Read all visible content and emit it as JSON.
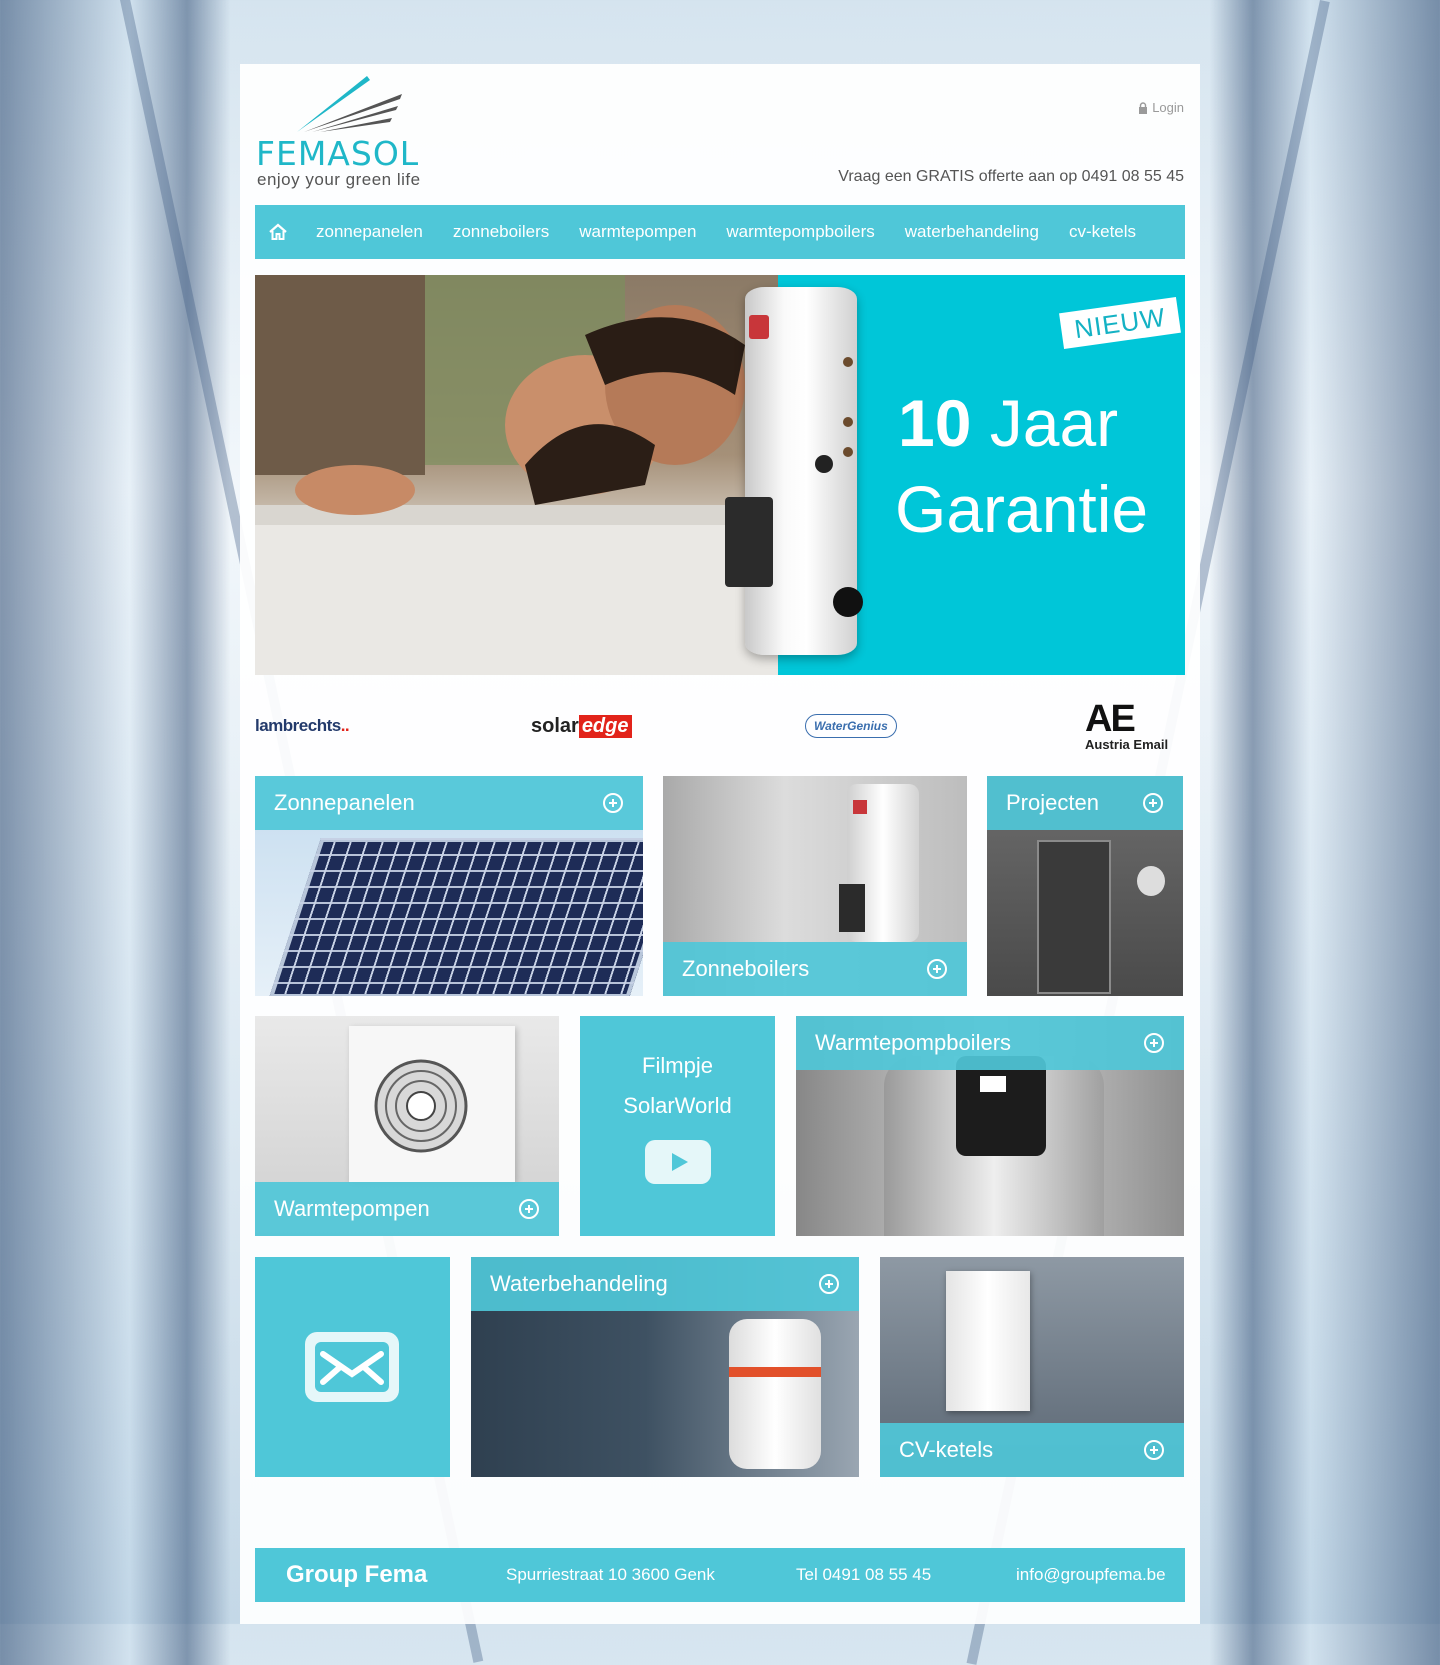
{
  "header": {
    "logo_name": "FEMASOL",
    "logo_tagline": "enjoy your green life",
    "login_label": "Login",
    "offer_text": "Vraag een GRATIS offerte aan op 0491 08 55 45"
  },
  "nav": {
    "home_icon": "home-icon",
    "items": [
      {
        "label": "zonnepanelen"
      },
      {
        "label": "zonneboilers"
      },
      {
        "label": "warmtepompen"
      },
      {
        "label": "warmtepompboilers"
      },
      {
        "label": "waterbehandeling"
      },
      {
        "label": "cv-ketels"
      }
    ]
  },
  "hero": {
    "badge": "NIEUW",
    "line1_bold": "10",
    "line1_rest": " Jaar",
    "line2": "Garantie"
  },
  "partners": {
    "lambrechts": "lambrechts",
    "solar": "solar",
    "edge": "edge",
    "watergenius": "WaterGenius",
    "ae": "AE",
    "ae_sub": "Austria Email"
  },
  "tiles": {
    "zonnepanelen": "Zonnepanelen",
    "zonneboilers": "Zonneboilers",
    "projecten": "Projecten",
    "warmtepompen": "Warmtepompen",
    "filmpje_line1": "Filmpje",
    "filmpje_line2": "SolarWorld",
    "warmtepompboilers": "Warmtepompboilers",
    "waterbehandeling": "Waterbehandeling",
    "cv_ketels": "CV-ketels"
  },
  "footer": {
    "brand": "Group Fema",
    "address": "Spurriestraat 10 3600 Genk",
    "phone": "Tel 0491 08 55 45",
    "email": "info@groupfema.be"
  },
  "colors": {
    "accent": "#4fc7d8",
    "hero_accent": "#00c6d8",
    "logo": "#1fb7c8"
  }
}
